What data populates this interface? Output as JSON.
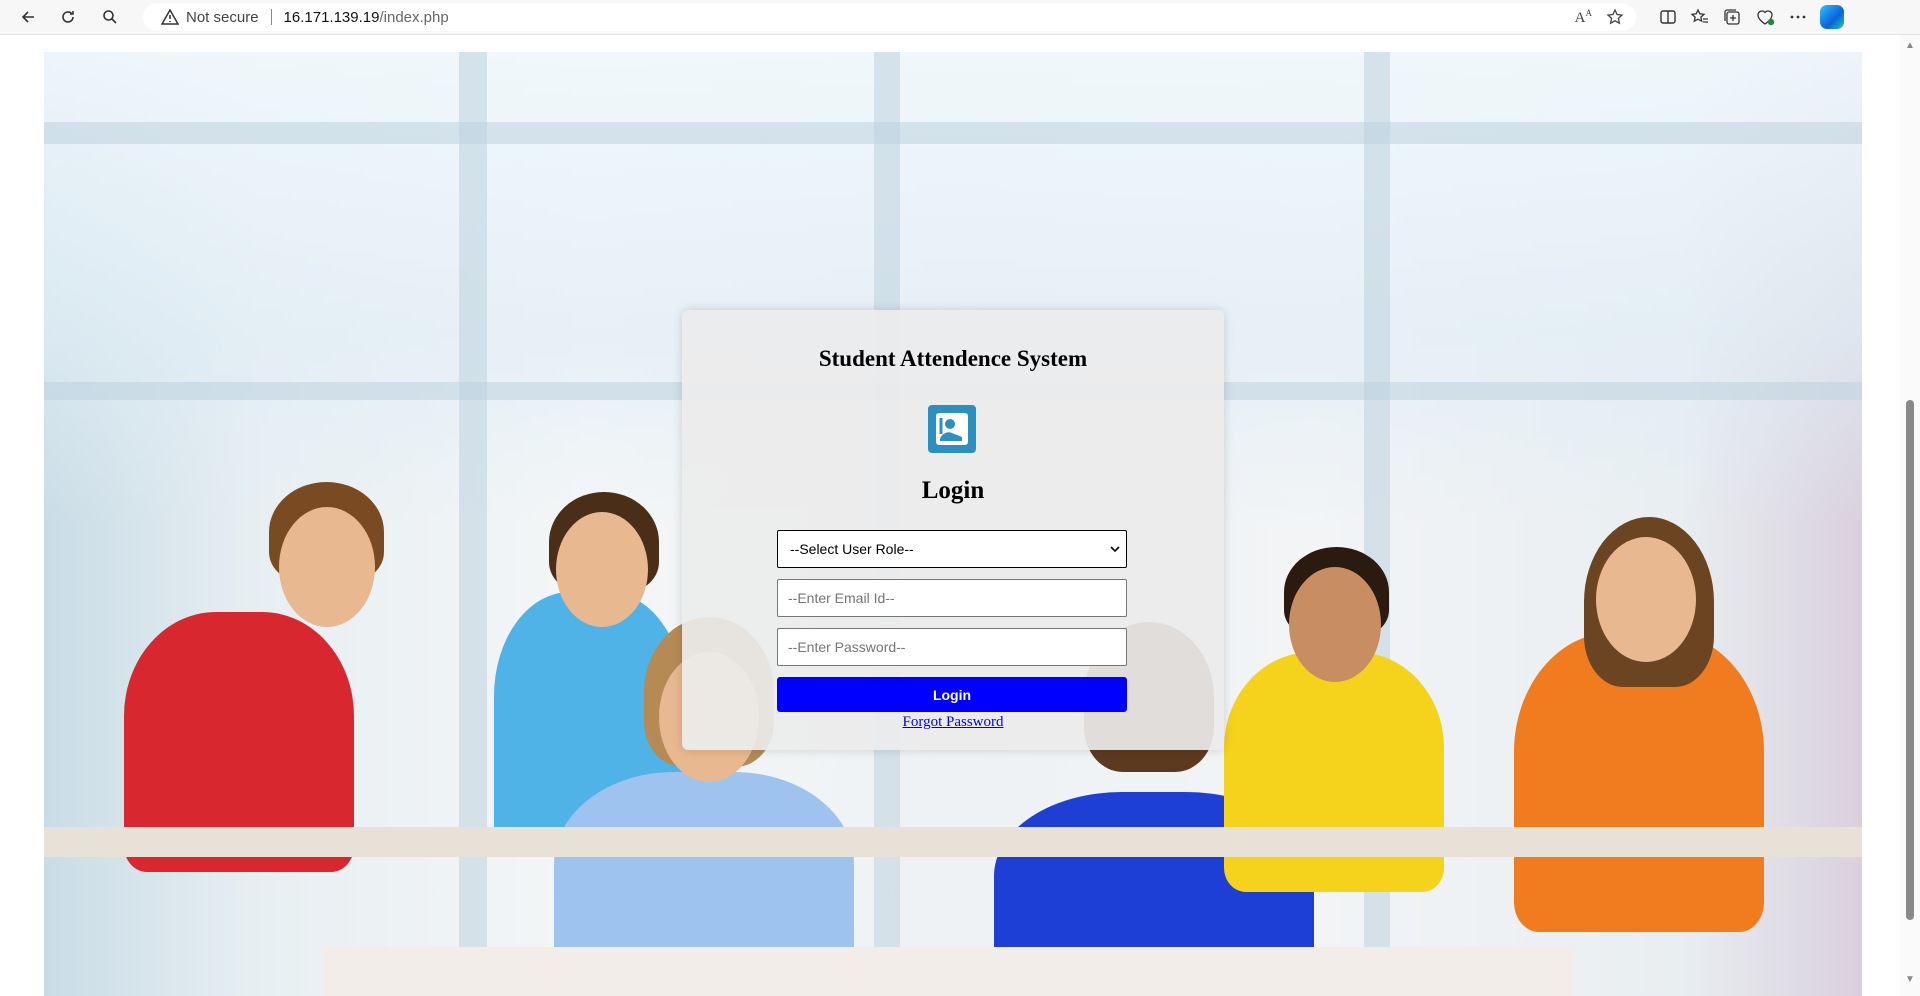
{
  "browser": {
    "security_label": "Not secure",
    "url_host": "16.171.139.19",
    "url_path": "/index.php",
    "icons": [
      "back-icon",
      "refresh-icon",
      "search-icon",
      "warning-icon",
      "read-aloud-icon",
      "favorite-star-icon",
      "split-screen-icon",
      "favorites-icon",
      "collections-icon",
      "browser-essentials-icon",
      "more-icon",
      "copilot-icon"
    ]
  },
  "login_card": {
    "title": "Student Attendence System",
    "heading": "Login",
    "role_select": {
      "selected": "--Select User Role--"
    },
    "email_placeholder": "--Enter Email Id--",
    "password_placeholder": "--Enter Password--",
    "login_button": "Login",
    "forgot_link": "Forgot Password"
  },
  "colors": {
    "button_bg": "#0000ff",
    "link": "#0000ee",
    "logo_bg": "#2b8fbf",
    "card_bg": "#ececec"
  }
}
